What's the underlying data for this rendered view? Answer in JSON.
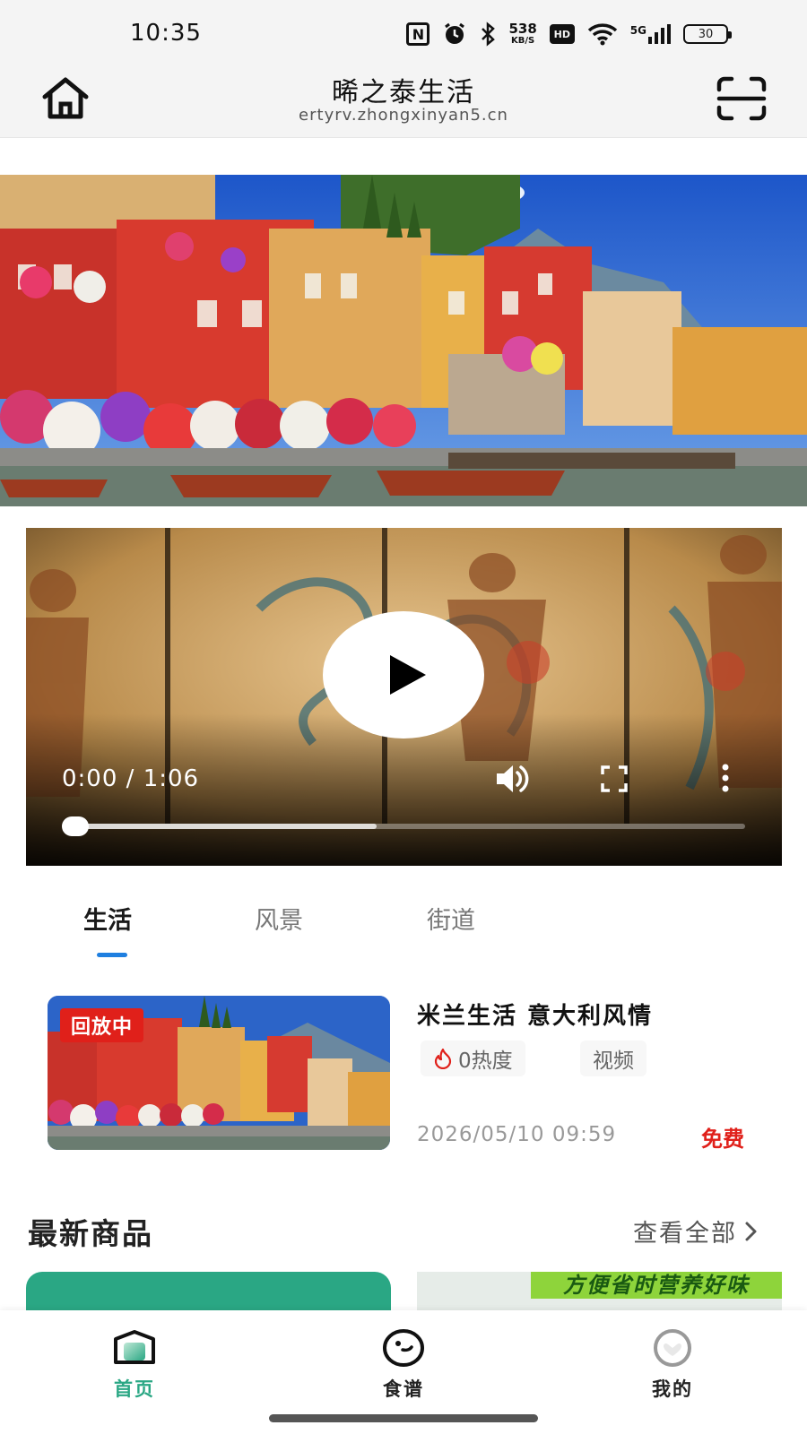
{
  "status_bar": {
    "time": "10:35",
    "nfc": "N",
    "net_speed_value": "538",
    "net_speed_unit": "KB/S",
    "hd": "HD",
    "network": "5G",
    "battery": "30",
    "icons": [
      "nfc-icon",
      "alarm-icon",
      "bluetooth-icon",
      "net-speed-icon",
      "hd-icon",
      "wifi-icon",
      "cellular-signal-icon",
      "battery-icon"
    ]
  },
  "header": {
    "title": "晞之泰生活",
    "url": "ertyrv.zhongxinyan5.cn",
    "left_icon": "home-icon",
    "right_icon": "scan-icon"
  },
  "banner": {
    "image": "lakeside-italian-town-photo"
  },
  "video": {
    "current_time": "0:00",
    "separator": " / ",
    "duration": "1:06",
    "buffered_fraction": 0.45,
    "played_fraction": 0.0,
    "icons": [
      "play-icon",
      "volume-icon",
      "fullscreen-icon",
      "more-vertical-icon"
    ]
  },
  "tabs": [
    {
      "label": "生活",
      "active": true
    },
    {
      "label": "风景",
      "active": false
    },
    {
      "label": "街道",
      "active": false
    }
  ],
  "card": {
    "badge": "回放中",
    "title": "米兰生活 意大利风情",
    "heat": "0热度",
    "type": "视频",
    "date": "2026/05/10 09:59",
    "price": "免费"
  },
  "section": {
    "title": "最新商品",
    "view_all": "查看全部"
  },
  "products": {
    "right_banner": "方便省时营养好味"
  },
  "nav": [
    {
      "label": "首页",
      "icon": "home-tab-icon",
      "active": true
    },
    {
      "label": "食谱",
      "icon": "recipe-icon",
      "active": false
    },
    {
      "label": "我的",
      "icon": "profile-icon",
      "active": false
    }
  ],
  "colors": {
    "accent_green": "#2aa784",
    "tab_underline": "#1f7fe0",
    "price_red": "#e0201a"
  }
}
